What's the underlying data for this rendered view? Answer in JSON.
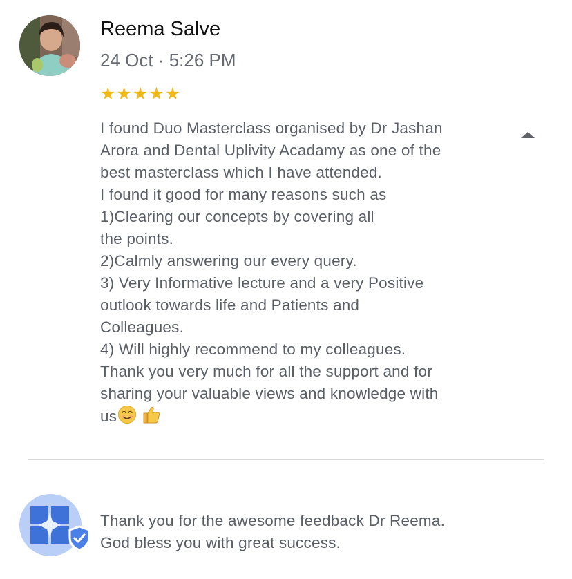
{
  "review": {
    "reviewer_name": "Reema Salve",
    "date": "24 Oct · 5:26 PM",
    "rating": 5,
    "rating_max": 5,
    "star_glyph": "★",
    "star_color": "#f3b81c",
    "text_lines": [
      "I found Duo Masterclass organised by Dr Jashan",
      "Arora and Dental Uplivity Acadamy as one of the",
      "best masterclass which I have attended.",
      "I found it good for many reasons such as",
      "1)Clearing our concepts by covering all",
      "the points.",
      "2)Calmly answering our every query.",
      "3) Very Informative lecture and a very Positive",
      "outlook towards life and Patients and",
      "Colleagues.",
      "4) Will highly recommend to my colleagues.",
      "Thank you very much for all the support and for",
      "sharing your valuable views and knowledge with",
      "us"
    ],
    "trailing_emojis": [
      "smiling-face-emoji",
      "thumbs-up-emoji"
    ],
    "collapse_icon": "caret-up-icon"
  },
  "reply": {
    "text_lines": [
      "Thank you for the awesome feedback Dr Reema.",
      "God bless you with great success."
    ],
    "owner_icon": "business-profile-icon",
    "badge_icon": "verified-shield-icon",
    "accent_color": "#4a80e8"
  }
}
